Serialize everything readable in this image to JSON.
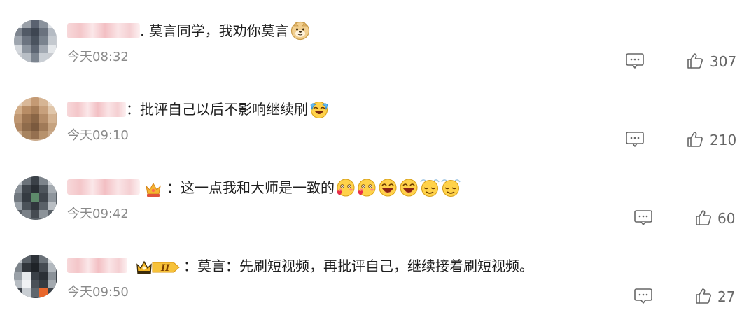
{
  "comments": [
    {
      "content": ". 莫言同学，我劝你莫言",
      "time": "今天08:32",
      "likes": "307",
      "emojis": [
        "doge-emoji"
      ]
    },
    {
      "content": "：批评自己以后不影响继续刷",
      "time": "今天09:10",
      "likes": "210",
      "emojis": [
        "laugh-cry-emoji"
      ]
    },
    {
      "content": "：这一点我和大师是一致的",
      "time": "今天09:42",
      "likes": "60",
      "emojis": [
        "shy-heart-emoji",
        "shy-heart-emoji",
        "laugh-emoji",
        "laugh-emoji",
        "relieved-emoji",
        "relieved-emoji"
      ]
    },
    {
      "content": "：莫言：先刷短视频，再批评自己，继续接着刷短视频。",
      "time": "今天09:50",
      "likes": "27",
      "emojis": [],
      "badge_level": "II"
    }
  ],
  "colors": {
    "text": "#1f1f1f",
    "time": "#8a8a8a",
    "icon": "#666666",
    "name_blur": "#f3c3c6"
  }
}
